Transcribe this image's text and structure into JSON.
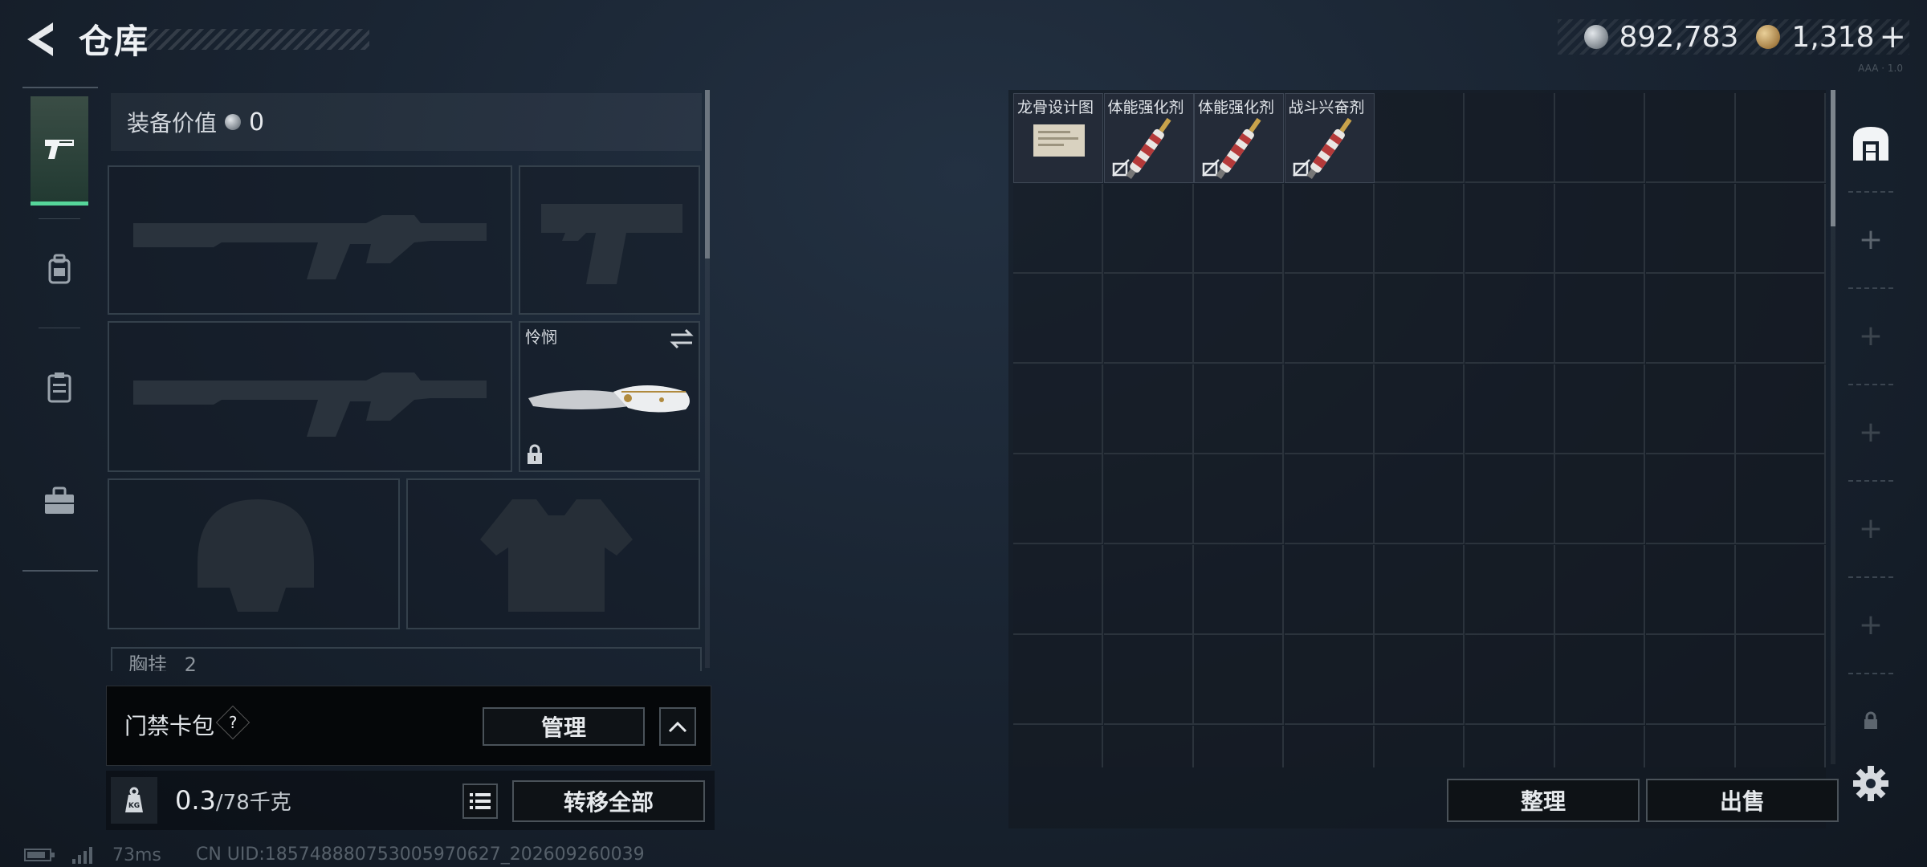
{
  "header": {
    "title": "仓库",
    "currencies": [
      {
        "icon": "silver-coin-icon",
        "value": "892,783"
      },
      {
        "icon": "gold-coin-icon",
        "value": "1,318"
      }
    ],
    "add_currency": "+",
    "version_note": "AAA · 1.0"
  },
  "sidebar": {
    "tabs": [
      {
        "icon": "pistol-icon",
        "active": true
      },
      {
        "icon": "backpack-icon",
        "active": false
      },
      {
        "icon": "clipboard-icon",
        "active": false
      },
      {
        "icon": "toolbox-icon",
        "active": false
      }
    ]
  },
  "equipment": {
    "value_label": "装备价值",
    "value": "0",
    "melee_name": "怜悯",
    "chest_label": "胸挂",
    "chest_count": "2"
  },
  "access_card": {
    "label": "门禁卡包",
    "help": "?",
    "manage_label": "管理"
  },
  "weight": {
    "current": "0.3",
    "max": "/78千克",
    "transfer_label": "转移全部"
  },
  "status": {
    "ping": "73ms",
    "uid": "CN UID:18574888075300597062​7_202609260039"
  },
  "warehouse": {
    "items": [
      {
        "name": "龙骨设计图",
        "type": "blueprint"
      },
      {
        "name": "体能强化剂",
        "type": "injector"
      },
      {
        "name": "体能强化剂",
        "type": "injector"
      },
      {
        "name": "战斗兴奋剂",
        "type": "injector"
      }
    ],
    "sort_label": "整理",
    "sell_label": "出售"
  },
  "colors": {
    "accent": "#56d69a",
    "background": "#1a2533",
    "button_border": "#4a5259"
  }
}
